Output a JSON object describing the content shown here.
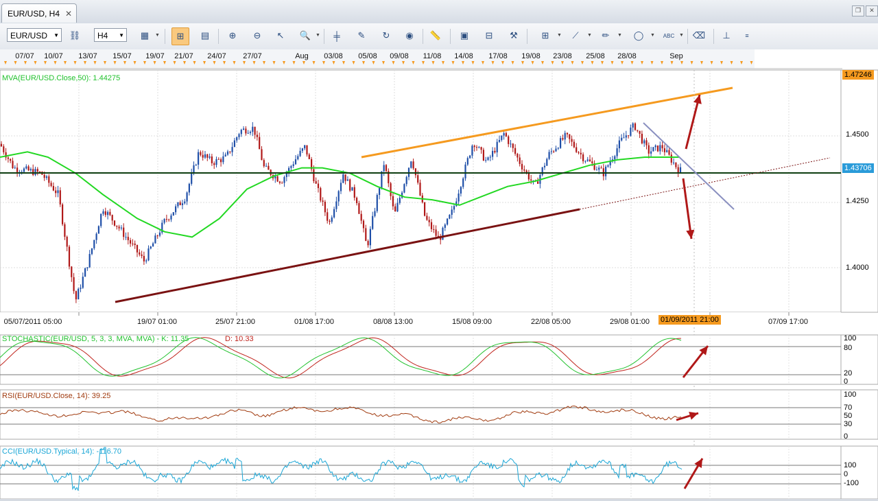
{
  "tab": {
    "title": "EUR/USD, H4"
  },
  "toolbar": {
    "symbol": "EUR/USD",
    "timeframe": "H4"
  },
  "top_dates": [
    "07/07",
    "10/07",
    "13/07",
    "15/07",
    "19/07",
    "21/07",
    "24/07",
    "27/07",
    "Aug",
    "03/08",
    "05/08",
    "09/08",
    "11/08",
    "14/08",
    "17/08",
    "19/08",
    "23/08",
    "25/08",
    "28/08",
    "Sep"
  ],
  "bottom_dates": [
    "05/07/2011 05:00",
    "19/07 01:00",
    "25/07 21:00",
    "01/08 17:00",
    "08/08 13:00",
    "15/08 09:00",
    "22/08 05:00",
    "29/08 01:00",
    "07/09 17:00"
  ],
  "cursor_date": "01/09/2011 21:00",
  "main_panel": {
    "indicator_label": "MVA(EUR/USD.Close,50): 1.44275",
    "price_ticks": [
      "1.4500",
      "1.4250",
      "1.4000"
    ],
    "top_price": "1.47246",
    "current_price": "1.43706"
  },
  "stochastic": {
    "label": "STOCHASTIC(EUR/USD, 5, 3, 3, MVA, MVA) -  K: 11.35",
    "d_label": "D: 10.33",
    "ticks": [
      "100",
      "80",
      "20",
      "0"
    ]
  },
  "rsi": {
    "label": "RSI(EUR/USD.Close, 14): 39.25",
    "ticks": [
      "100",
      "70",
      "50",
      "30",
      "0"
    ]
  },
  "cci": {
    "label": "CCI(EUR/USD.Typical, 14): -116.70",
    "ticks": [
      "100",
      "0",
      "-100"
    ]
  },
  "colors": {
    "bull": "#1f4fa8",
    "bear": "#b01818",
    "mva": "#22d822",
    "resistance": "#f59a1f",
    "support": "#7a1212",
    "arrow": "#b01818",
    "stoch_k": "#22c22e",
    "stoch_d": "#c0231c",
    "rsi": "#a03a0e",
    "cci": "#1aa6d6"
  }
}
